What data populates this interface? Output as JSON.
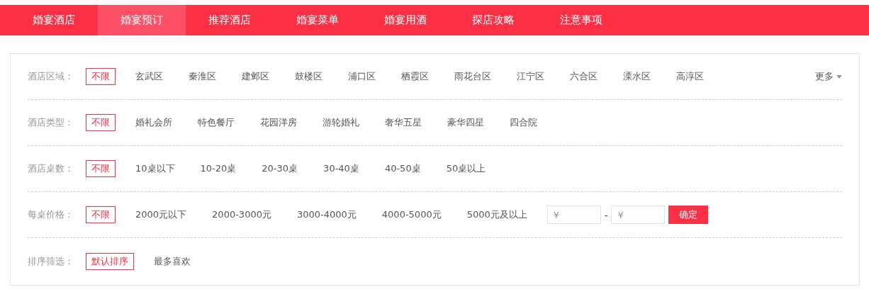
{
  "nav": [
    {
      "label": "婚宴酒店",
      "selected": false
    },
    {
      "label": "婚宴预订",
      "selected": true
    },
    {
      "label": "推荐酒店",
      "selected": false
    },
    {
      "label": "婚宴菜单",
      "selected": false
    },
    {
      "label": "婚宴用酒",
      "selected": false
    },
    {
      "label": "探店攻略",
      "selected": false
    },
    {
      "label": "注意事项",
      "selected": false
    }
  ],
  "filters": [
    {
      "label": "酒店区域：",
      "options": [
        {
          "label": "不限",
          "selected": true
        },
        {
          "label": "玄武区",
          "selected": false
        },
        {
          "label": "秦淮区",
          "selected": false
        },
        {
          "label": "建邺区",
          "selected": false
        },
        {
          "label": "鼓楼区",
          "selected": false
        },
        {
          "label": "浦口区",
          "selected": false
        },
        {
          "label": "栖霞区",
          "selected": false
        },
        {
          "label": "雨花台区",
          "selected": false
        },
        {
          "label": "江宁区",
          "selected": false
        },
        {
          "label": "六合区",
          "selected": false
        },
        {
          "label": "溧水区",
          "selected": false
        },
        {
          "label": "高淳区",
          "selected": false
        }
      ],
      "more": "更多"
    },
    {
      "label": "酒店类型：",
      "options": [
        {
          "label": "不限",
          "selected": true
        },
        {
          "label": "婚礼会所",
          "selected": false
        },
        {
          "label": "特色餐厅",
          "selected": false
        },
        {
          "label": "花园洋房",
          "selected": false
        },
        {
          "label": "游轮婚礼",
          "selected": false
        },
        {
          "label": "奢华五星",
          "selected": false
        },
        {
          "label": "豪华四星",
          "selected": false
        },
        {
          "label": "四合院",
          "selected": false
        }
      ]
    },
    {
      "label": "酒店桌数：",
      "options": [
        {
          "label": "不限",
          "selected": true
        },
        {
          "label": "10桌以下",
          "selected": false
        },
        {
          "label": "10-20桌",
          "selected": false
        },
        {
          "label": "20-30桌",
          "selected": false
        },
        {
          "label": "30-40桌",
          "selected": false
        },
        {
          "label": "40-50桌",
          "selected": false
        },
        {
          "label": "50桌以上",
          "selected": false
        }
      ]
    },
    {
      "label": "每桌价格：",
      "options": [
        {
          "label": "不限",
          "selected": true
        },
        {
          "label": "2000元以下",
          "selected": false
        },
        {
          "label": "2000-3000元",
          "selected": false
        },
        {
          "label": "3000-4000元",
          "selected": false
        },
        {
          "label": "4000-5000元",
          "selected": false
        },
        {
          "label": "5000元及以上",
          "selected": false
        }
      ],
      "range": {
        "min_placeholder": "¥",
        "separator": "-",
        "max_placeholder": "¥",
        "button": "确定"
      }
    },
    {
      "label": "排序筛选：",
      "options": [
        {
          "label": "默认排序",
          "selected": true
        },
        {
          "label": "最多喜欢",
          "selected": false
        }
      ]
    }
  ]
}
